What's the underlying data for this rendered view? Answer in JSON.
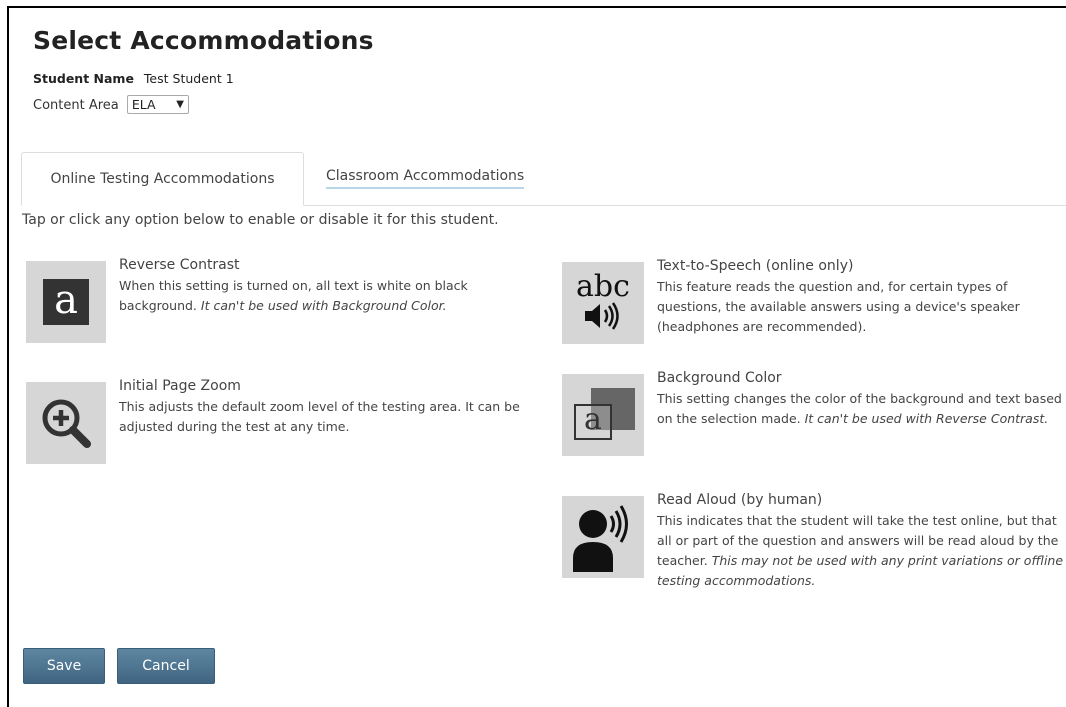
{
  "page": {
    "title": "Select Accommodations",
    "student_label": "Student Name",
    "student_value": "Test Student 1",
    "content_area_label": "Content Area",
    "content_area_value": "ELA"
  },
  "tabs": [
    {
      "label": "Online Testing Accommodations",
      "active": true
    },
    {
      "label": "Classroom Accommodations",
      "active": false
    }
  ],
  "instructions": "Tap or click any option below to enable or disable it for this student.",
  "options": {
    "reverse_contrast": {
      "icon": "reverse-contrast-icon",
      "title": "Reverse Contrast",
      "desc": "When this setting is turned on, all text is white on black background.",
      "note": "It can't be used with Background Color."
    },
    "initial_zoom": {
      "icon": "zoom-in-icon",
      "title": "Initial Page Zoom",
      "desc": "This adjusts the default zoom level of the testing area. It can be adjusted during the test at any time."
    },
    "text_to_speech": {
      "icon": "text-to-speech-icon",
      "title": "Text-to-Speech (online only)",
      "desc": "This feature reads the question and, for certain types of questions, the available answers using a device's speaker (headphones are recommended)."
    },
    "background_color": {
      "icon": "background-color-icon",
      "title": "Background Color",
      "desc": "This setting changes the color of the background and text based on the selection made.",
      "note": "It can't be used with Reverse Contrast."
    },
    "read_aloud": {
      "icon": "read-aloud-icon",
      "title": "Read Aloud (by human)",
      "desc": "This indicates that the student will take the test online, but that all or part of the question and answers will be read aloud by the teacher.",
      "note": "This may not be used with any print variations or offline testing accommodations."
    }
  },
  "glyphs": {
    "reverse_contrast": "a",
    "tts_text": "abc",
    "background_color": "a"
  },
  "buttons": {
    "save": "Save",
    "cancel": "Cancel"
  },
  "colors": {
    "button": "#4a7090",
    "icon_bg": "#d6d6d6",
    "tab_underline": "#b8d6e8"
  }
}
